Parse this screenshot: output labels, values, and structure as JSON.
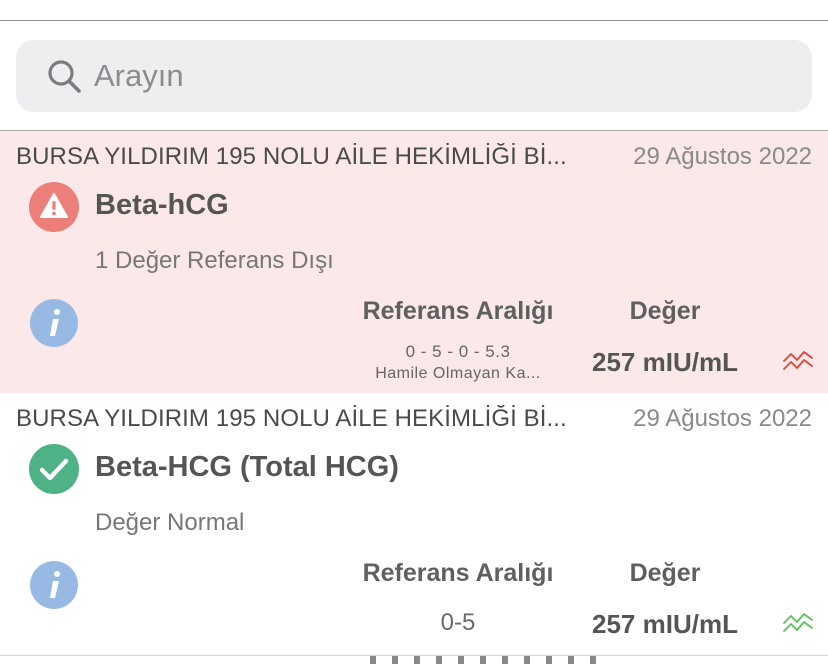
{
  "search": {
    "placeholder": "Arayın",
    "value": ""
  },
  "results": [
    {
      "institution": "BURSA YILDIRIM 195  NOLU AİLE HEKİMLİĞİ Bİ...",
      "date": "29 Ağustos 2022",
      "test_name": "Beta-hCG",
      "status": "abnormal",
      "status_text": "1 Değer Referans Dışı",
      "status_icon": "warning-icon",
      "ref_header": "Referans Aralığı",
      "value_header": "Değer",
      "ref_range": "0 - 5 - 0 - 5.3",
      "ref_note": "Hamile Olmayan Ka...",
      "value": "257 mIU/mL",
      "trend_icon": "trend-chart-icon",
      "trend_color": "#e0453b",
      "background": "#fbe8e8"
    },
    {
      "institution": "BURSA YILDIRIM 195  NOLU AİLE HEKİMLİĞİ Bİ...",
      "date": "29 Ağustos 2022",
      "test_name": "Beta-HCG (Total HCG)",
      "status": "normal",
      "status_text": "Değer Normal",
      "status_icon": "checkmark-icon",
      "ref_header": "Referans Aralığı",
      "value_header": "Değer",
      "ref_range": "0-5",
      "value": "257 mIU/mL",
      "trend_icon": "trend-chart-icon",
      "trend_color": "#5cc35a",
      "background": "#ffffff"
    }
  ],
  "colors": {
    "warning": "#ed7f7a",
    "success": "#4fb286",
    "info": "#97b9e4",
    "search_bg": "#eeeef0"
  }
}
